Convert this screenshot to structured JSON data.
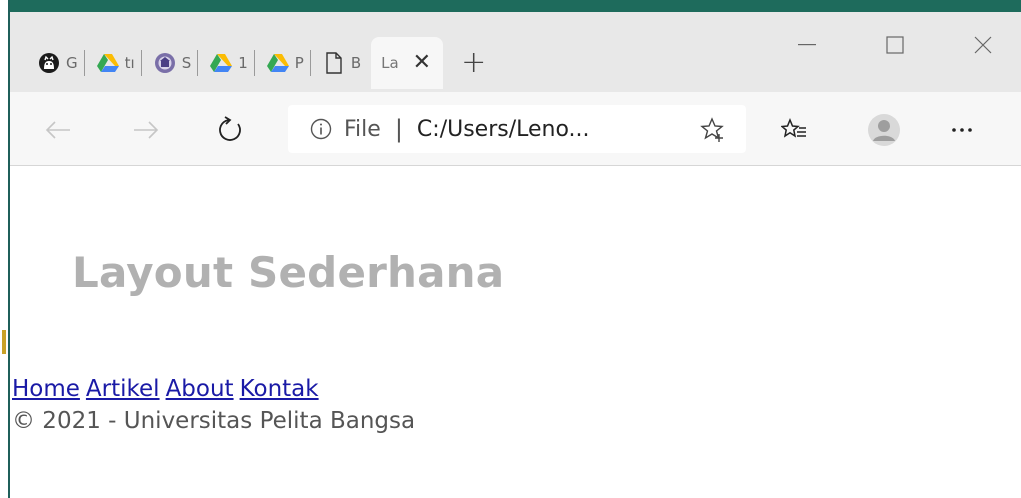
{
  "colors": {
    "title_gray": "#b1b1b1",
    "link_blue": "#1a1aa6",
    "footer_gray": "#555555",
    "tabstrip_bg": "#e8e8e8",
    "toolbar_bg": "#f7f7f7",
    "accent_edge": "#1e6b5c"
  },
  "tabs": [
    {
      "title": "G",
      "icon": "github-icon"
    },
    {
      "title": "tı",
      "icon": "google-drive-icon"
    },
    {
      "title": "S",
      "icon": "university-logo-icon"
    },
    {
      "title": "1",
      "icon": "google-drive-icon"
    },
    {
      "title": "P",
      "icon": "google-drive-icon"
    },
    {
      "title": "B",
      "icon": "file-icon"
    },
    {
      "title": "La",
      "icon": "none",
      "active": true
    }
  ],
  "window_controls": [
    "minimize-icon",
    "maximize-icon",
    "close-icon"
  ],
  "address_bar": {
    "scheme_label": "File",
    "separator": "|",
    "url_text": "C:/Users/Leno..."
  },
  "page": {
    "title": "Layout Sederhana",
    "nav": [
      "Home",
      "Artikel",
      "About",
      "Kontak"
    ],
    "footer": "© 2021 - Universitas Pelita Bangsa"
  }
}
